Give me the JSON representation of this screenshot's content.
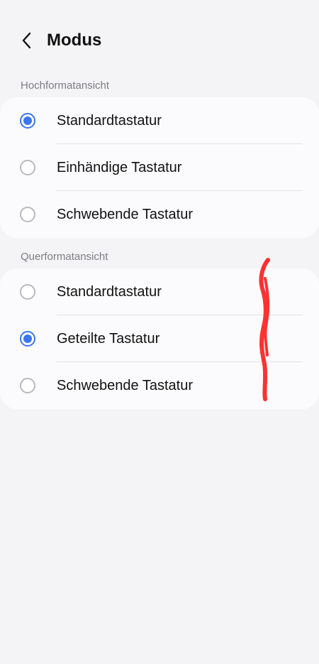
{
  "header": {
    "title": "Modus",
    "back_icon": "chevron-left-icon"
  },
  "sections": [
    {
      "label": "Hochformatansicht",
      "options": [
        {
          "label": "Standardtastatur",
          "selected": true
        },
        {
          "label": "Einhändige Tastatur",
          "selected": false
        },
        {
          "label": "Schwebende Tastatur",
          "selected": false
        }
      ]
    },
    {
      "label": "Querformatansicht",
      "options": [
        {
          "label": "Standardtastatur",
          "selected": false
        },
        {
          "label": "Geteilte Tastatur",
          "selected": true
        },
        {
          "label": "Schwebende Tastatur",
          "selected": false
        }
      ]
    }
  ],
  "colors": {
    "accent": "#3b76ec",
    "background": "#f4f4f6",
    "card": "#fbfbfd",
    "annotation": "#ff3131"
  }
}
